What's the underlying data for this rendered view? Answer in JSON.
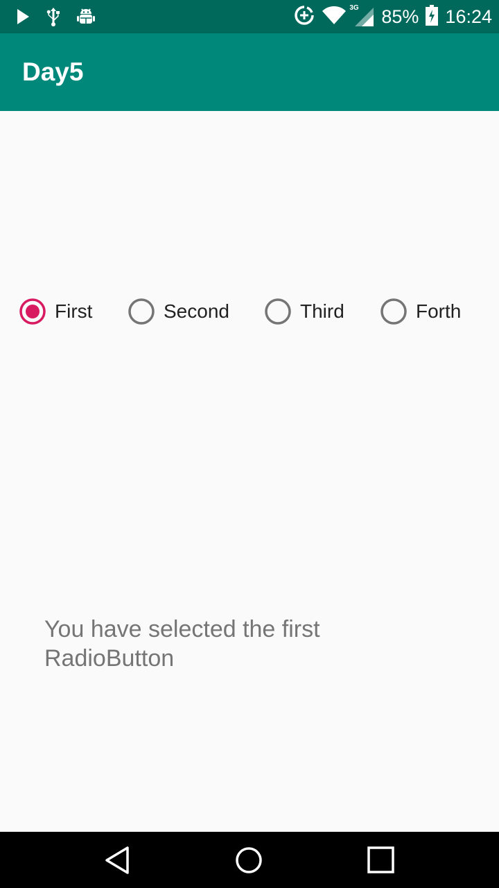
{
  "status_bar": {
    "battery_percent": "85%",
    "time": "16:24",
    "network_type": "3G",
    "left_icons": [
      "play-icon",
      "usb-icon",
      "android-debug-icon"
    ],
    "right_icons": [
      "data-saver-icon",
      "wifi-icon",
      "cell-signal-icon",
      "battery-charging-icon"
    ]
  },
  "app_bar": {
    "title": "Day5",
    "color": "#00897b",
    "status_color": "#00695c"
  },
  "radio_group": {
    "accent_color": "#d81b60",
    "selected_index": 0,
    "options": [
      {
        "label": "First",
        "checked": true
      },
      {
        "label": "Second",
        "checked": false
      },
      {
        "label": "Third",
        "checked": false
      },
      {
        "label": "Forth",
        "checked": false
      }
    ]
  },
  "message": {
    "text": "You have selected the first RadioButton"
  },
  "nav_bar": {
    "icons": [
      "back-icon",
      "home-icon",
      "recents-icon"
    ]
  }
}
